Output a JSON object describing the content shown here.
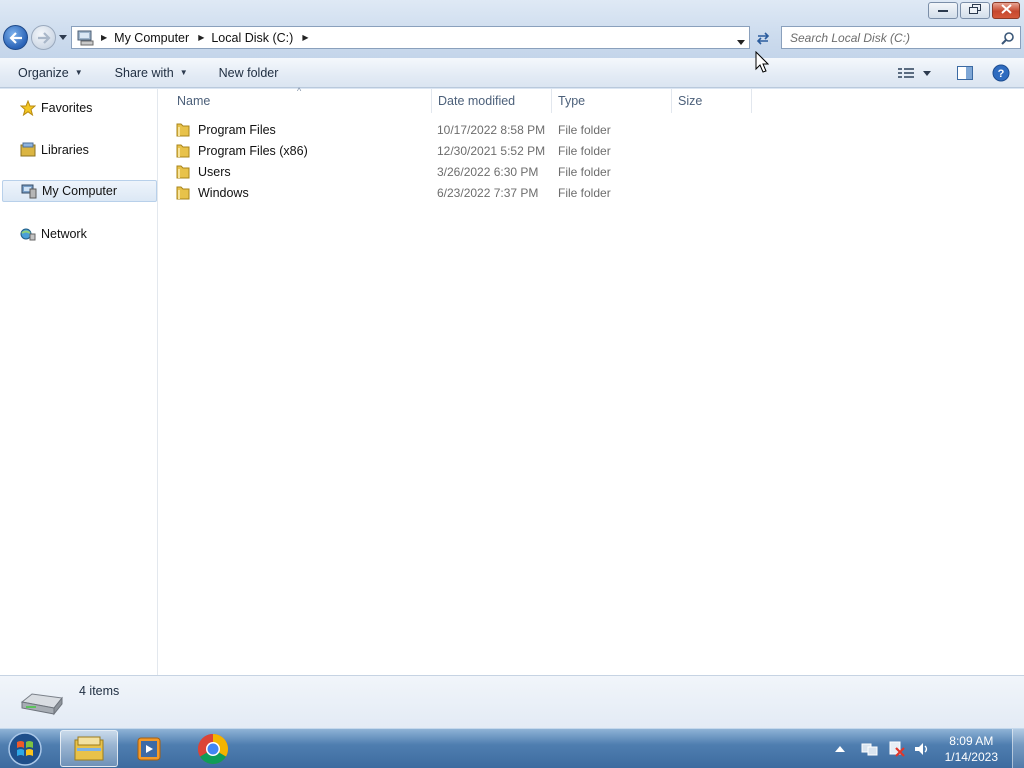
{
  "window": {
    "controls": {
      "minimize_icon": "minimize-icon",
      "restore_icon": "restore-icon",
      "close_icon": "close-icon"
    }
  },
  "navigation": {
    "breadcrumbs": [
      "My Computer",
      "Local Disk (C:)"
    ],
    "search_placeholder": "Search Local Disk (C:)"
  },
  "command_bar": {
    "organize": "Organize",
    "share_with": "Share with",
    "new_folder": "New folder"
  },
  "nav_pane": {
    "items": [
      {
        "label": "Favorites",
        "icon": "star-icon"
      },
      {
        "label": "Libraries",
        "icon": "libraries-icon"
      },
      {
        "label": "My Computer",
        "icon": "computer-icon",
        "selected": true
      },
      {
        "label": "Network",
        "icon": "network-icon"
      }
    ]
  },
  "file_list": {
    "columns": [
      "Name",
      "Date modified",
      "Type",
      "Size"
    ],
    "rows": [
      {
        "name": "Program Files",
        "date": "10/17/2022 8:58 PM",
        "type": "File folder",
        "size": ""
      },
      {
        "name": "Program Files (x86)",
        "date": "12/30/2021 5:52 PM",
        "type": "File folder",
        "size": ""
      },
      {
        "name": "Users",
        "date": "3/26/2022 6:30 PM",
        "type": "File folder",
        "size": ""
      },
      {
        "name": "Windows",
        "date": "6/23/2022 7:37 PM",
        "type": "File folder",
        "size": ""
      }
    ]
  },
  "details": {
    "item_count": "4 items"
  },
  "taskbar": {
    "apps": [
      "explorer-icon",
      "media-player-icon",
      "chrome-icon"
    ],
    "time": "8:09 AM",
    "date": "1/14/2023"
  },
  "colors": {
    "accent": "#2a63b7",
    "folder": "#e8c24a",
    "taskbar": "#4f7eb0"
  }
}
